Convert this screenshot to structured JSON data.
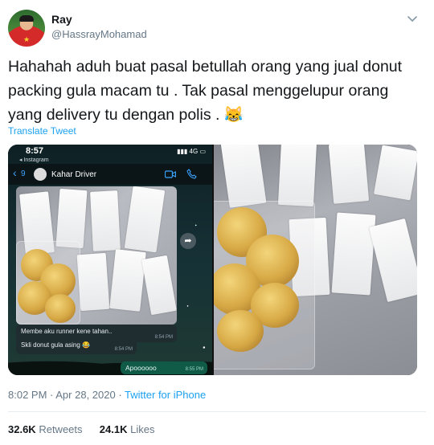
{
  "user": {
    "display_name": "Ray",
    "handle": "@HassrayMohamad"
  },
  "tweet": {
    "text": "Hahahah aduh buat pasal betullah orang yang jual donut packing gula macam tu . Tak pasal menggelupur orang yang delivery tu dengan polis . 😹",
    "translate_label": "Translate Tweet"
  },
  "media": {
    "phone": {
      "time": "8:57",
      "back_app": "◂ Instagram",
      "network": "4G",
      "back_count": "9",
      "chat_name": "Kahar Driver",
      "messages": [
        {
          "text": "Membe aku runner kene tahan..",
          "time": "8:54 PM"
        },
        {
          "text": "Skli donut gula asing 😂",
          "time": "8:54 PM"
        }
      ],
      "reply": {
        "text": "Apoooooo",
        "time": "8:55 PM"
      }
    }
  },
  "meta": {
    "time": "8:02 PM",
    "separator": " · ",
    "date": "Apr 28, 2020",
    "client": "Twitter for iPhone"
  },
  "stats": {
    "retweets_count": "32.6K",
    "retweets_label": "Retweets",
    "likes_count": "24.1K",
    "likes_label": "Likes"
  },
  "icons": {
    "caret": "chevron-down-icon",
    "video": "video-call-icon",
    "phone": "phone-call-icon",
    "forward": "forward-icon"
  },
  "colors": {
    "link": "#1da1f2",
    "secondary_text": "#657786",
    "primary_text": "#14171a"
  }
}
